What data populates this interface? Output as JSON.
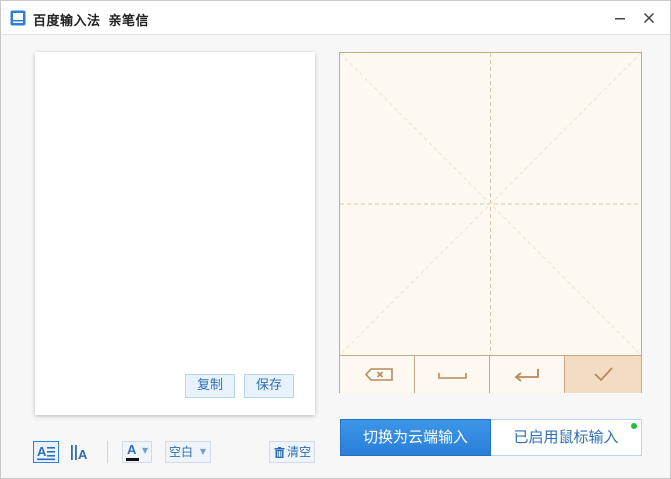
{
  "window": {
    "title": "百度输入法",
    "subtitle": "亲笔信",
    "minimize_icon": "minimize-icon",
    "close_icon": "close-icon"
  },
  "result": {
    "text": "",
    "copy_label": "复制",
    "save_label": "保存"
  },
  "toolbar": {
    "text_layout_icon": "horizontal-text-icon",
    "vertical_layout_icon": "vertical-text-icon",
    "font_color_letter": "A",
    "font_color": "#111111",
    "background_value": "空白",
    "clear_label": "清空",
    "clear_icon": "trash-icon"
  },
  "pad": {
    "backspace_icon": "backspace-icon",
    "space_icon": "space-icon",
    "enter_icon": "enter-icon",
    "confirm_icon": "checkmark-icon"
  },
  "modes": {
    "cloud_label": "切换为云端输入",
    "mouse_label": "已启用鼠标输入",
    "mouse_status_color": "#22c03b"
  },
  "colors": {
    "accent": "#2a7fd6",
    "pad_border": "#c8aa86",
    "pad_background": "#fdf9f1"
  }
}
